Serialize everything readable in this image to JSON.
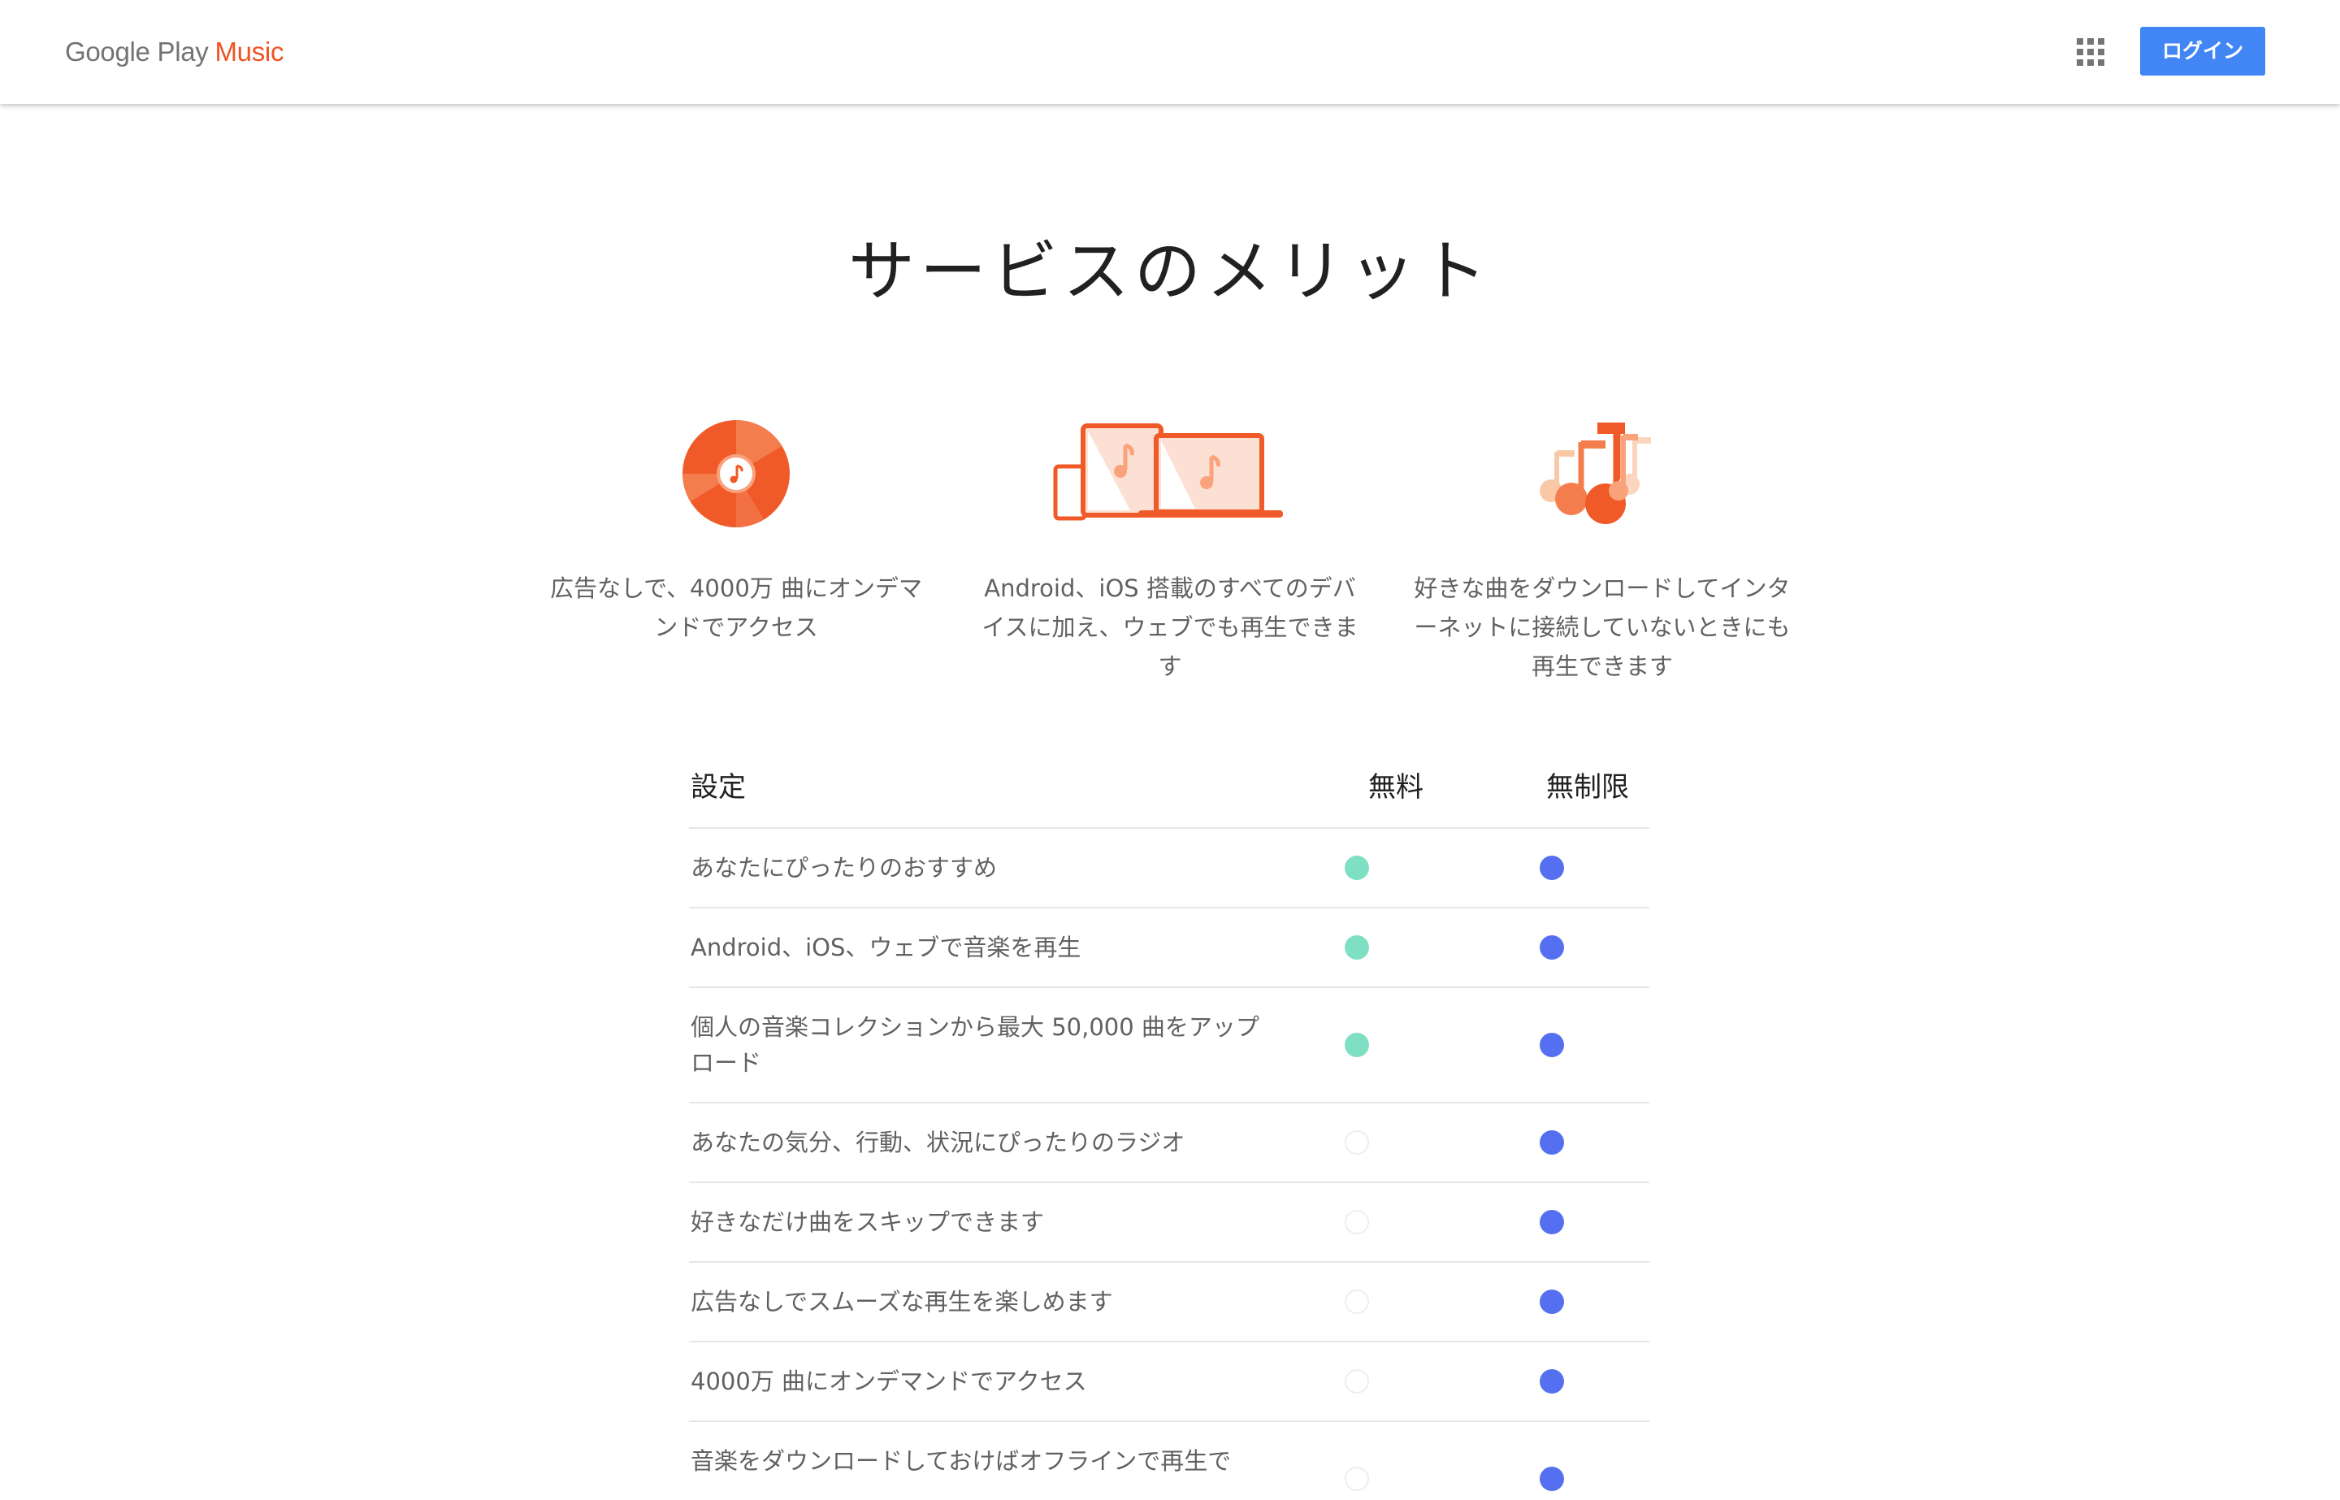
{
  "header": {
    "logo_google_play": "Google Play",
    "logo_music": "Music",
    "apps_icon": "apps-grid-icon",
    "login_label": "ログイン"
  },
  "page_title": "サービスのメリット",
  "features": [
    {
      "icon": "vinyl-record-icon",
      "text": "広告なしで、4000万 曲にオンデマンドでアクセス"
    },
    {
      "icon": "devices-icon",
      "text": "Android、iOS 搭載のすべてのデバイスに加え、ウェブでも再生できます"
    },
    {
      "icon": "music-notes-icon",
      "text": "好きな曲をダウンロードしてインターネットに接続していないときにも再生できます"
    }
  ],
  "comparison": {
    "headers": {
      "setting": "設定",
      "free": "無料",
      "unlimited": "無制限"
    },
    "rows": [
      {
        "label": "あなたにぴったりのおすすめ",
        "free": true,
        "unlimited": true
      },
      {
        "label": "Android、iOS、ウェブで音楽を再生",
        "free": true,
        "unlimited": true
      },
      {
        "label": "個人の音楽コレクションから最大 50,000 曲をアップロード",
        "free": true,
        "unlimited": true
      },
      {
        "label": "あなたの気分、行動、状況にぴったりのラジオ",
        "free": false,
        "unlimited": true
      },
      {
        "label": "好きなだけ曲をスキップできます",
        "free": false,
        "unlimited": true
      },
      {
        "label": "広告なしでスムーズな再生を楽しめます",
        "free": false,
        "unlimited": true
      },
      {
        "label": "4000万 曲にオンデマンドでアクセス",
        "free": false,
        "unlimited": true
      },
      {
        "label": "音楽をダウンロードしておけばオフラインで再生で",
        "free": false,
        "unlimited": true
      }
    ]
  },
  "colors": {
    "brand_orange": "#ef5323",
    "login_blue": "#4285f4",
    "free_dot": "#7fdfc3",
    "unlimited_dot": "#5470f0"
  }
}
